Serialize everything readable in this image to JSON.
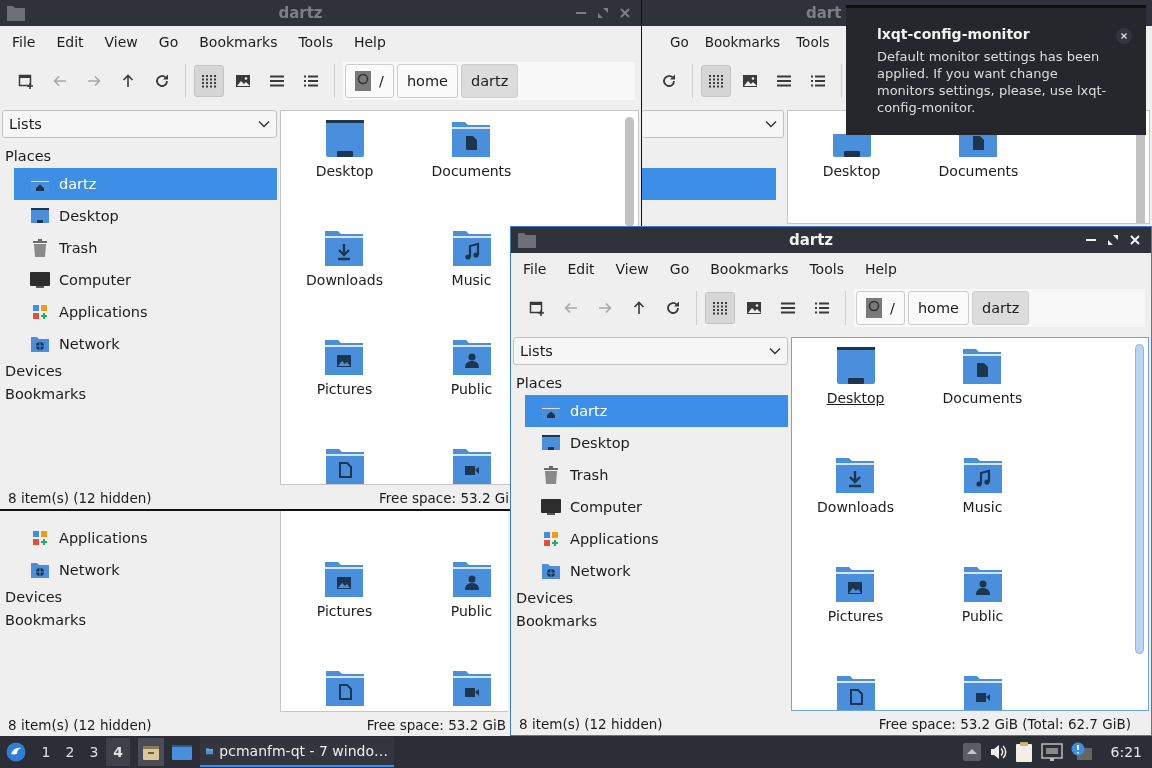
{
  "windows": [
    {
      "title": "dartz",
      "active": false,
      "controls": true,
      "menu": [
        "File",
        "Edit",
        "View",
        "Go",
        "Bookmarks",
        "Tools",
        "Help"
      ],
      "toolbar": [
        {
          "kind": "new-tab",
          "disabled": false
        },
        {
          "kind": "back",
          "disabled": true
        },
        {
          "kind": "forward",
          "disabled": true
        },
        {
          "kind": "up",
          "disabled": false
        },
        {
          "kind": "reload",
          "disabled": false
        }
      ],
      "views": [
        {
          "kind": "icons",
          "selected": true
        },
        {
          "kind": "thumbnails",
          "selected": false
        },
        {
          "kind": "compact",
          "selected": false
        },
        {
          "kind": "details",
          "selected": false
        }
      ],
      "path": [
        {
          "kind": "root",
          "label": "/",
          "selected": false
        },
        {
          "kind": "dir",
          "label": "home",
          "selected": false
        },
        {
          "kind": "dir",
          "label": "dartz",
          "selected": true
        }
      ],
      "sidebar": {
        "dropdown": true,
        "dropdown_label": "Lists",
        "header": "Places",
        "items": [
          {
            "kind": "home",
            "label": "dartz",
            "selected": true
          },
          {
            "kind": "desktop",
            "label": "Desktop",
            "selected": false
          },
          {
            "kind": "trash",
            "label": "Trash",
            "selected": false
          },
          {
            "kind": "computer",
            "label": "Computer",
            "selected": false
          },
          {
            "kind": "applications",
            "label": "Applications",
            "selected": false
          },
          {
            "kind": "network",
            "label": "Network",
            "selected": false
          }
        ],
        "sections": [
          "Devices",
          "Bookmarks"
        ]
      },
      "files": [
        {
          "name": "Desktop",
          "kind": "desktop"
        },
        {
          "name": "Documents",
          "kind": "documents"
        },
        {
          "name": "Downloads",
          "kind": "downloads"
        },
        {
          "name": "Music",
          "kind": "music"
        },
        {
          "name": "Pictures",
          "kind": "pictures"
        },
        {
          "name": "Public",
          "kind": "public"
        },
        {
          "kind": "templates"
        },
        {
          "kind": "videos"
        }
      ],
      "status": {
        "left": "8 item(s) (12 hidden)",
        "right": "Free space: 53.2 Gi"
      }
    },
    {
      "title": "dart",
      "active": false,
      "menu": [
        "Go",
        "Bookmarks",
        "Tools"
      ],
      "toolbar": [
        {
          "kind": "reload",
          "disabled": false
        }
      ],
      "views": [
        {
          "kind": "icons",
          "selected": true
        },
        {
          "kind": "thumbnails",
          "selected": false
        },
        {
          "kind": "compact",
          "selected": false
        },
        {
          "kind": "details",
          "selected": false
        }
      ],
      "sidebar": {
        "dropdown": true,
        "items": [
          {
            "selected": true
          }
        ]
      },
      "files": [
        {
          "name": "Desktop",
          "kind": "desktop"
        },
        {
          "name": "Documents",
          "kind": "documents"
        }
      ]
    },
    {
      "active": false,
      "sidebar": {
        "items": [
          {
            "kind": "applications",
            "label": "Applications",
            "selected": false
          },
          {
            "kind": "network",
            "label": "Network",
            "selected": false
          }
        ],
        "sections": [
          "Devices",
          "Bookmarks"
        ]
      },
      "files": [
        {
          "name": "Pictures",
          "kind": "pictures"
        },
        {
          "name": "Public",
          "kind": "public"
        },
        {
          "kind": "templates"
        },
        {
          "kind": "videos"
        }
      ],
      "status": {
        "left": "8 item(s) (12 hidden)",
        "right": "Free space: 53.2 GiB"
      }
    },
    {
      "title": "dartz",
      "active": true,
      "controls": true,
      "menu": [
        "File",
        "Edit",
        "View",
        "Go",
        "Bookmarks",
        "Tools",
        "Help"
      ],
      "toolbar": [
        {
          "kind": "new-tab",
          "disabled": false
        },
        {
          "kind": "back",
          "disabled": true
        },
        {
          "kind": "forward",
          "disabled": true
        },
        {
          "kind": "up",
          "disabled": false
        },
        {
          "kind": "reload",
          "disabled": false
        }
      ],
      "views": [
        {
          "kind": "icons",
          "selected": true
        },
        {
          "kind": "thumbnails",
          "selected": false
        },
        {
          "kind": "compact",
          "selected": false
        },
        {
          "kind": "details",
          "selected": false
        }
      ],
      "path": [
        {
          "kind": "root",
          "label": "/",
          "selected": false
        },
        {
          "kind": "dir",
          "label": "home",
          "selected": false
        },
        {
          "kind": "dir",
          "label": "dartz",
          "selected": true
        }
      ],
      "sidebar": {
        "dropdown": true,
        "dropdown_label": "Lists",
        "header": "Places",
        "items": [
          {
            "kind": "home",
            "label": "dartz",
            "selected": true
          },
          {
            "kind": "desktop",
            "label": "Desktop",
            "selected": false
          },
          {
            "kind": "trash",
            "label": "Trash",
            "selected": false
          },
          {
            "kind": "computer",
            "label": "Computer",
            "selected": false
          },
          {
            "kind": "applications",
            "label": "Applications",
            "selected": false
          },
          {
            "kind": "network",
            "label": "Network",
            "selected": false
          }
        ],
        "sections": [
          "Devices",
          "Bookmarks"
        ]
      },
      "files": [
        {
          "name": "Desktop",
          "kind": "desktop",
          "focused": true
        },
        {
          "name": "Documents",
          "kind": "documents",
          "focused": false
        },
        {
          "name": "Downloads",
          "kind": "downloads",
          "focused": false
        },
        {
          "name": "Music",
          "kind": "music",
          "focused": false
        },
        {
          "name": "Pictures",
          "kind": "pictures",
          "focused": false
        },
        {
          "name": "Public",
          "kind": "public",
          "focused": false
        },
        {
          "kind": "templates"
        },
        {
          "kind": "videos"
        }
      ],
      "status": {
        "left": "8 item(s) (12 hidden)",
        "right": "Free space: 53.2 GiB (Total: 62.7 GiB)"
      }
    }
  ],
  "notification": {
    "title": "lxqt-config-monitor",
    "body": "Default monitor settings has been applied. If you want change monitors settings, please, use lxqt-config-monitor."
  },
  "taskbar": {
    "workspaces": [
      {
        "label": "1",
        "selected": false
      },
      {
        "label": "2",
        "selected": false
      },
      {
        "label": "3",
        "selected": false
      },
      {
        "label": "4",
        "selected": true
      }
    ],
    "task": "pcmanfm-qt - 7 windo…",
    "clock": "6:21"
  }
}
